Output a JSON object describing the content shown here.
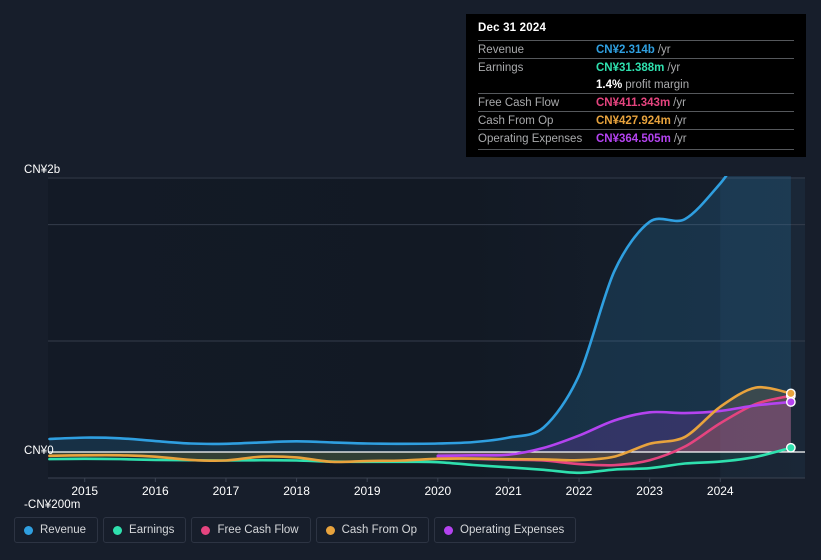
{
  "theme": {
    "background": "#171e2b",
    "plot_background": "#131a26",
    "gridline": "#343c4b",
    "zero_line": "#ffffff",
    "axis_text": "#ffffff"
  },
  "tooltip": {
    "title": "Dec 31 2024",
    "rows": [
      {
        "label": "Revenue",
        "value": "CN¥2.314b",
        "suffix": "/yr",
        "color": "#2f9fe0",
        "rule": true
      },
      {
        "label": "Earnings",
        "value": "CN¥31.388m",
        "suffix": "/yr",
        "color": "#2fe0ae",
        "rule": true
      },
      {
        "label": "",
        "value": "1.4%",
        "suffix": "profit margin",
        "color": "#ffffff",
        "rule": false
      },
      {
        "label": "Free Cash Flow",
        "value": "CN¥411.343m",
        "suffix": "/yr",
        "color": "#e5447f",
        "rule": true
      },
      {
        "label": "Cash From Op",
        "value": "CN¥427.924m",
        "suffix": "/yr",
        "color": "#e8a33d",
        "rule": true
      },
      {
        "label": "Operating Expenses",
        "value": "CN¥364.505m",
        "suffix": "/yr",
        "color": "#b443f0",
        "rule": true
      }
    ]
  },
  "legend": {
    "items": [
      {
        "label": "Revenue",
        "color": "#2f9fe0"
      },
      {
        "label": "Earnings",
        "color": "#2fe0ae"
      },
      {
        "label": "Free Cash Flow",
        "color": "#e5447f"
      },
      {
        "label": "Cash From Op",
        "color": "#e8a33d"
      },
      {
        "label": "Operating Expenses",
        "color": "#b443f0"
      }
    ]
  },
  "chart_data": {
    "type": "area",
    "title": "",
    "xlabel": "",
    "ylabel": "",
    "grid": true,
    "legend_position": "bottom",
    "currency": "CN¥",
    "units": "millions",
    "x": [
      2014.5,
      2015.0,
      2015.5,
      2016.0,
      2016.5,
      2017.0,
      2017.5,
      2018.0,
      2018.5,
      2019.0,
      2019.5,
      2020.0,
      2020.5,
      2021.0,
      2021.5,
      2022.0,
      2022.5,
      2023.0,
      2023.5,
      2024.0,
      2024.5,
      2025.0
    ],
    "y_axis": {
      "ticks": [
        {
          "value": 2000,
          "label": "CN¥2b"
        },
        {
          "value": 0,
          "label": "CN¥0"
        },
        {
          "value": -200,
          "label": "-CN¥200m"
        }
      ],
      "gridline_values": [
        2000,
        1660,
        810
      ],
      "ylim": [
        -220,
        2000
      ]
    },
    "x_axis": {
      "tick_labels": [
        "2015",
        "2016",
        "2017",
        "2018",
        "2019",
        "2020",
        "2021",
        "2022",
        "2023",
        "2024"
      ],
      "tick_values": [
        2015,
        2016,
        2017,
        2018,
        2019,
        2020,
        2021,
        2022,
        2023,
        2024
      ],
      "xlim": [
        2014.48,
        2025.2
      ],
      "highlight_from": 2024.0
    },
    "series": [
      {
        "name": "Revenue",
        "color": "#2f9fe0",
        "fill": "rgba(47,159,224,0.17)",
        "values": [
          95,
          105,
          100,
          80,
          62,
          60,
          70,
          78,
          70,
          62,
          60,
          62,
          72,
          105,
          180,
          560,
          1320,
          1680,
          1700,
          1960,
          2290,
          2314
        ]
      },
      {
        "name": "Earnings",
        "color": "#2fe0ae",
        "fill": "rgba(47,224,174,0.10)",
        "values": [
          -52,
          -50,
          -52,
          -58,
          -60,
          -62,
          -60,
          -62,
          -70,
          -72,
          -72,
          -74,
          -95,
          -112,
          -130,
          -152,
          -128,
          -118,
          -84,
          -70,
          -36,
          31
        ]
      },
      {
        "name": "Free Cash Flow",
        "color": "#e5447f",
        "fill": "rgba(229,68,127,0.17)",
        "start_index": 11,
        "values": [
          null,
          null,
          null,
          null,
          null,
          null,
          null,
          null,
          null,
          null,
          null,
          -40,
          -50,
          -56,
          -62,
          -88,
          -96,
          -60,
          40,
          210,
          350,
          411
        ]
      },
      {
        "name": "Cash From Op",
        "color": "#e8a33d",
        "fill": "rgba(232,163,61,0.15)",
        "values": [
          -28,
          -24,
          -24,
          -34,
          -58,
          -62,
          -34,
          -40,
          -72,
          -66,
          -62,
          -50,
          -48,
          -52,
          -54,
          -60,
          -34,
          60,
          110,
          330,
          470,
          428
        ]
      },
      {
        "name": "Operating Expenses",
        "color": "#b443f0",
        "fill": "rgba(180,67,240,0.18)",
        "start_index": 11,
        "values": [
          null,
          null,
          null,
          null,
          null,
          null,
          null,
          null,
          null,
          null,
          null,
          -28,
          -24,
          -20,
          30,
          120,
          230,
          290,
          284,
          300,
          340,
          365
        ]
      }
    ]
  }
}
